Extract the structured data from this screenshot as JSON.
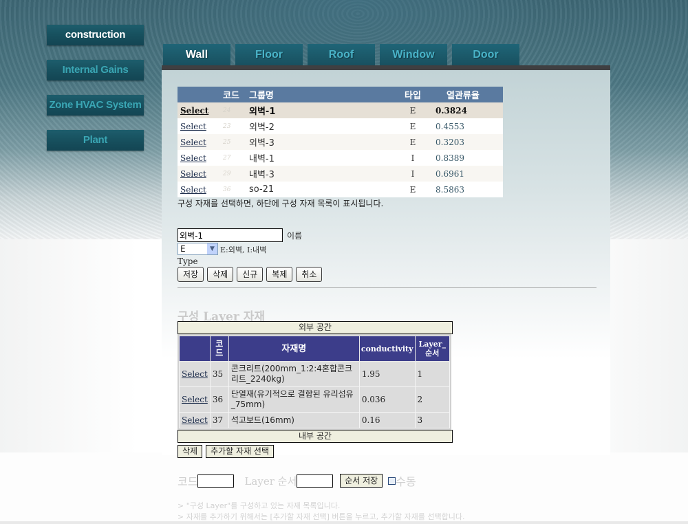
{
  "sidebar": {
    "items": [
      {
        "label": "construction",
        "active": true
      },
      {
        "label": "Internal Gains",
        "active": false
      },
      {
        "label": "Zone HVAC System",
        "active": false
      },
      {
        "label": "Plant",
        "active": false
      }
    ]
  },
  "tabs": [
    {
      "label": "Wall",
      "active": true
    },
    {
      "label": "Floor",
      "active": false
    },
    {
      "label": "Roof",
      "active": false
    },
    {
      "label": "Window",
      "active": false
    },
    {
      "label": "Door",
      "active": false
    }
  ],
  "group_table": {
    "headers": {
      "select": "",
      "code": "코드",
      "name": "그룹명",
      "type": "타입",
      "value": "열관류율"
    },
    "rows": [
      {
        "select": "Select",
        "code": "24",
        "name": "외벽-1",
        "type": "E",
        "value": "0.3824",
        "selected": true
      },
      {
        "select": "Select",
        "code": "23",
        "name": "외벽-2",
        "type": "E",
        "value": "0.4553"
      },
      {
        "select": "Select",
        "code": "25",
        "name": "외벽-3",
        "type": "E",
        "value": "0.3203"
      },
      {
        "select": "Select",
        "code": "27",
        "name": "내벽-1",
        "type": "I",
        "value": "0.8389"
      },
      {
        "select": "Select",
        "code": "29",
        "name": "내벽-3",
        "type": "I",
        "value": "0.6961"
      },
      {
        "select": "Select",
        "code": "36",
        "name": "so-21",
        "type": "E",
        "value": "8.5863"
      }
    ]
  },
  "hint": "구성 자재를 선택하면, 하단에 구성 자재 목록이 표시됩니다.",
  "form": {
    "name_value": "외벽-1",
    "name_label": "이름",
    "type_selected": "E",
    "type_hint": "E:외벽, I:내벽",
    "type_label": "Type",
    "buttons": {
      "save": "저장",
      "delete": "삭제",
      "new": "신규",
      "copy": "복제",
      "cancel": "취소"
    }
  },
  "layer_section": {
    "title": "구성 Layer 자재",
    "outer_space": "외부 공간",
    "inner_space": "내부 공간",
    "headers": {
      "select": "",
      "code": "코드",
      "material": "자재명",
      "conductivity": "conductivity",
      "order": "Layer_순서"
    },
    "rows": [
      {
        "select": "Select",
        "code": "35",
        "material": "콘크리트(200mm_1:2:4혼합콘크리트_2240kg)",
        "conductivity": "1.95",
        "order": "1"
      },
      {
        "select": "Select",
        "code": "36",
        "material": "단열재(유기적으로 결합된 유리섬유_75mm)",
        "conductivity": "0.036",
        "order": "2"
      },
      {
        "select": "Select",
        "code": "37",
        "material": "석고보드(16mm)",
        "conductivity": "0.16",
        "order": "3"
      }
    ],
    "buttons": {
      "delete": "삭제",
      "add_material": "추가할 자재 선택"
    },
    "order_form": {
      "code_label": "코드",
      "code_value": "",
      "order_label": "Layer 순서",
      "order_value": "",
      "save_order": "순서 저장",
      "manual_label": "수동",
      "manual_checked": false
    },
    "notes": [
      "> \"구성 Layer\"를 구성하고 있는 자재 목록입니다.",
      "> 자재를 추가하기 위해서는 [추가할 자재 선택] 버튼을 누르고, 추가할 자재를 선택합니다."
    ]
  }
}
